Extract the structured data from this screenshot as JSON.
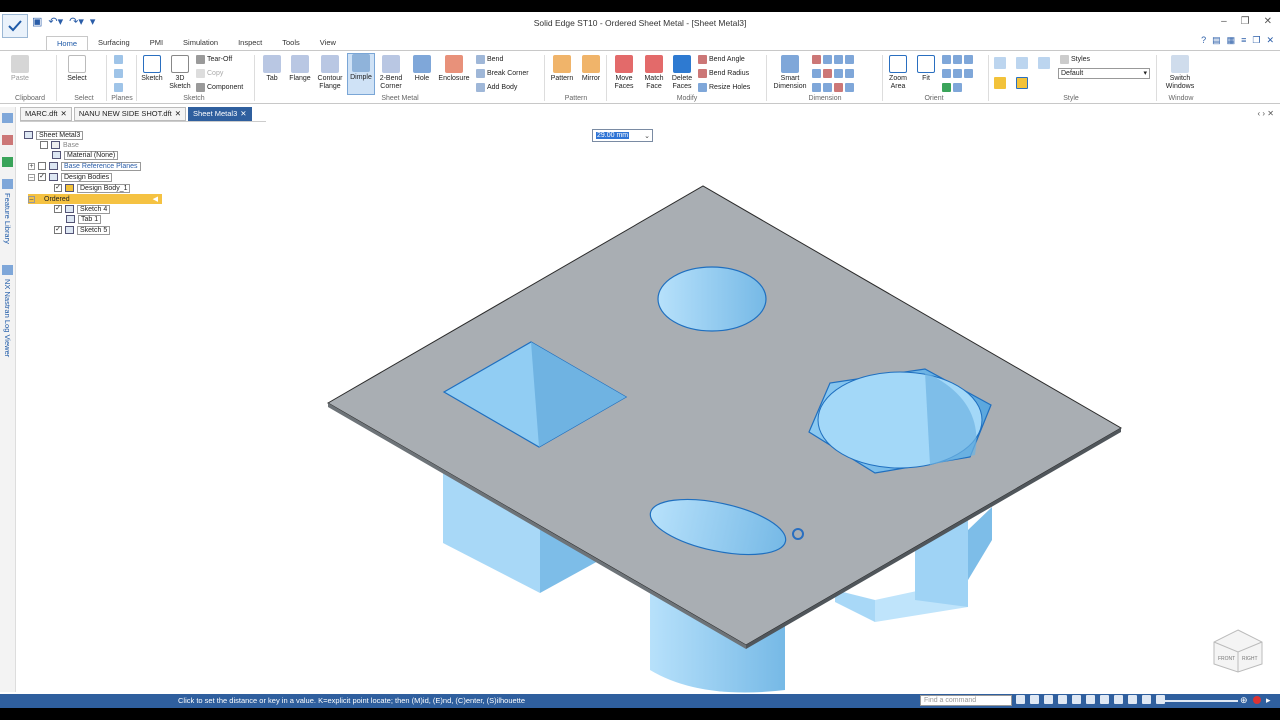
{
  "app": {
    "title": "Solid Edge ST10 - Ordered Sheet Metal - [Sheet Metal3]",
    "qat": [
      "save-icon",
      "undo-icon",
      "redo-icon",
      "customize-icon"
    ]
  },
  "ribbon_tabs": [
    "Home",
    "Surfacing",
    "PMI",
    "Simulation",
    "Inspect",
    "Tools",
    "View"
  ],
  "active_tab": "Home",
  "ribbon": {
    "clipboard": {
      "paste": "Paste",
      "group": "Clipboard"
    },
    "select": {
      "select": "Select",
      "group": "Select"
    },
    "planes": {
      "group": "Planes"
    },
    "sketch": {
      "sketch": "Sketch",
      "sketch3d_line1": "3D",
      "sketch3d_line2": "Sketch",
      "tearoff": "Tear-Off",
      "copy": "Copy",
      "component": "Component",
      "group": "Sketch"
    },
    "sheetmetal": {
      "tab": "Tab",
      "flange": "Flange",
      "contour_line1": "Contour",
      "contour_line2": "Flange",
      "dimple": "Dimple",
      "bend2_line1": "2-Bend",
      "bend2_line2": "Corner",
      "hole": "Hole",
      "enclosure": "Enclosure",
      "bend": "Bend",
      "break_corner": "Break Corner",
      "add_body": "Add Body",
      "group": "Sheet Metal"
    },
    "pattern": {
      "pattern": "Pattern",
      "mirror": "Mirror",
      "group": "Pattern"
    },
    "modify": {
      "move_line1": "Move",
      "move_line2": "Faces",
      "match_line1": "Match",
      "match_line2": "Face",
      "delete_line1": "Delete",
      "delete_line2": "Faces",
      "bend_angle": "Bend Angle",
      "bend_radius": "Bend Radius",
      "resize_holes": "Resize Holes",
      "group": "Modify"
    },
    "dimension": {
      "smart_line1": "Smart",
      "smart_line2": "Dimension",
      "group": "Dimension"
    },
    "orient": {
      "zoom_line1": "Zoom",
      "zoom_line2": "Area",
      "fit": "Fit",
      "group": "Orient"
    },
    "style": {
      "styles": "Styles",
      "default": "Default",
      "group": "Style"
    },
    "window": {
      "switch_line1": "Switch",
      "switch_line2": "Windows",
      "group": "Window"
    }
  },
  "doc_tabs": [
    "MARC.dft",
    "NANU NEW SIDE SHOT.dft",
    "Sheet Metal3"
  ],
  "left_strip": [
    "Feature Library",
    "NX Nastran Log Viewer"
  ],
  "tree": {
    "root": "Sheet Metal3",
    "base": "Base",
    "material": "Material (None)",
    "base_ref": "Base Reference Planes",
    "design_bodies": "Design Bodies",
    "design_body_1": "Design Body_1",
    "ordered": "Ordered",
    "sketch4": "Sketch 4",
    "tab1": "Tab 1",
    "sketch5": "Sketch 5"
  },
  "dimension_input": {
    "value": "29.00 mm"
  },
  "status": {
    "prompt": "Click to set the distance or key in a value.  K=explicit point locate; then (M)id, (E)nd, (C)enter, (S)ilhouette",
    "find_placeholder": "Find a command"
  },
  "navcube": {
    "front": "FRONT",
    "right": "RIGHT"
  },
  "colors": {
    "accent": "#2f5f9e",
    "plate": "#a9aeb3",
    "cutout": "#8ec9f0",
    "highlight": "#f5c242"
  }
}
